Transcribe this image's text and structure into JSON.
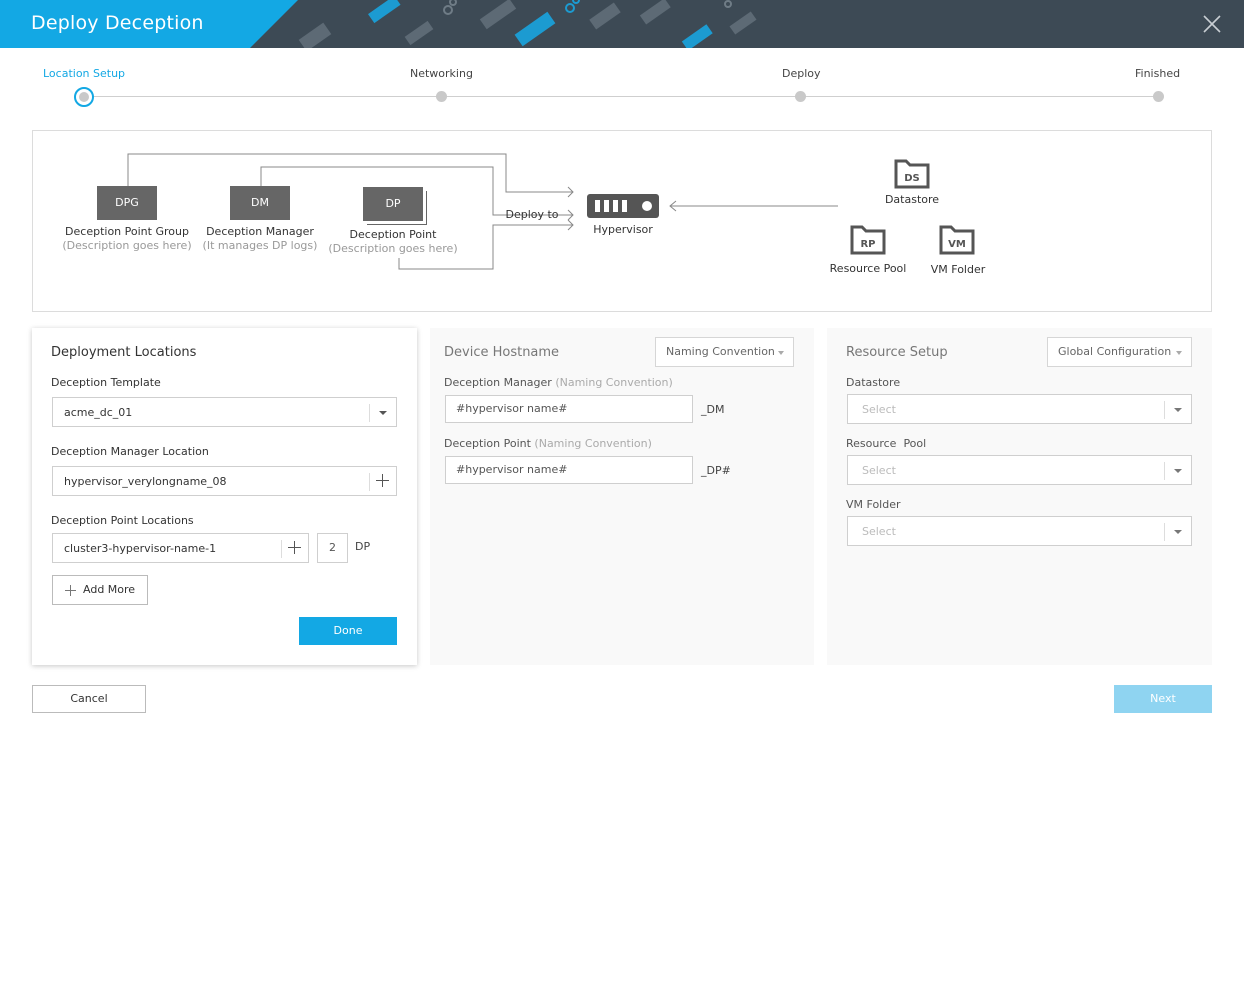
{
  "header": {
    "title": "Deploy Deception"
  },
  "steps": [
    {
      "label": "Location Setup",
      "active": true
    },
    {
      "label": "Networking",
      "active": false
    },
    {
      "label": "Deploy",
      "active": false
    },
    {
      "label": "Finished",
      "active": false
    }
  ],
  "diagram": {
    "dpg": {
      "box": "DPG",
      "name": "Deception Point Group",
      "desc": "(Description goes here)"
    },
    "dm": {
      "box": "DM",
      "name": "Deception Manager",
      "desc": "(It manages DP logs)"
    },
    "dp": {
      "box": "DP",
      "name": "Deception Point",
      "desc": "(Description goes here)"
    },
    "deploy_to": "Deploy to",
    "hypervisor": "Hypervisor",
    "datastore": {
      "icon": "DS",
      "name": "Datastore"
    },
    "resource_pool": {
      "icon": "RP",
      "name": "Resource Pool"
    },
    "vm_folder": {
      "icon": "VM",
      "name": "VM Folder"
    }
  },
  "deployment": {
    "title": "Deployment Locations",
    "template_label": "Deception Template",
    "template_value": "acme_dc_01",
    "dm_location_label": "Deception Manager Location",
    "dm_location_value": "hypervisor_verylongname_08",
    "dp_locations_label": "Deception Point Locations",
    "dp_location_value": "cluster3-hypervisor-name-1",
    "dp_count": "2",
    "dp_unit": "DP",
    "add_more": "Add More",
    "done": "Done"
  },
  "hostname": {
    "title": "Device Hostname",
    "naming_dropdown": "Naming Convention",
    "dm_label": "Deception Manager",
    "dm_hint": "(Naming Convention)",
    "dm_placeholder": "#hypervisor name#",
    "dm_suffix": "_DM",
    "dp_label": "Deception Point",
    "dp_hint": "(Naming Convention)",
    "dp_placeholder": "#hypervisor name#",
    "dp_suffix": "_DP#"
  },
  "resource": {
    "title": "Resource Setup",
    "config_dropdown": "Global Configuration",
    "datastore_label": "Datastore",
    "datastore_placeholder": "Select",
    "pool_label": "Resource  Pool",
    "pool_placeholder": "Select",
    "folder_label": "VM Folder",
    "folder_placeholder": "Select"
  },
  "footer": {
    "cancel": "Cancel",
    "next": "Next"
  },
  "colors": {
    "accent": "#13a8e4",
    "header_dark": "#3d4a55",
    "box_gray": "#666666"
  }
}
